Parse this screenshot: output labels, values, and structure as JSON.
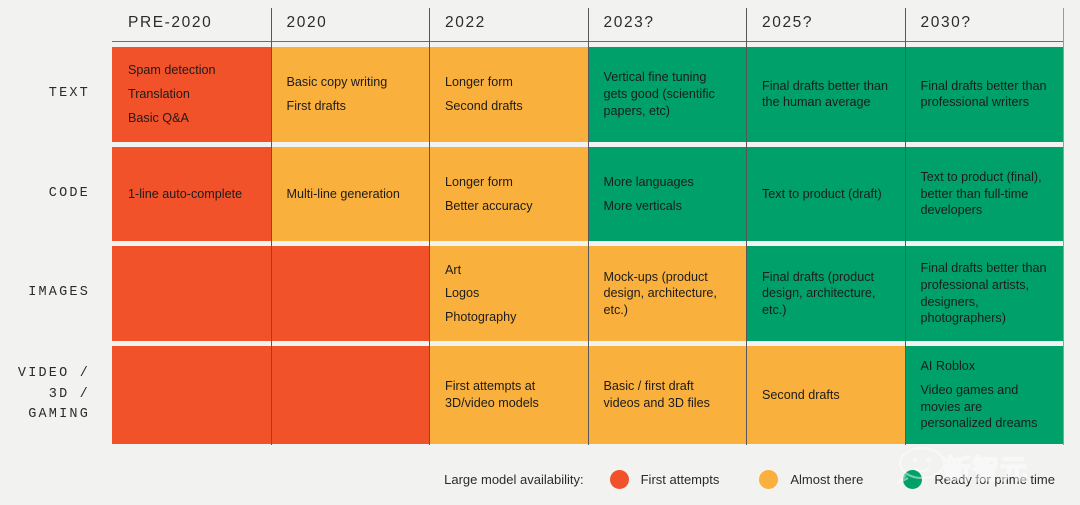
{
  "chart_data": {
    "type": "table",
    "title": "",
    "columns": [
      "PRE-2020",
      "2020",
      "2022",
      "2023?",
      "2025?",
      "2030?"
    ],
    "rows": [
      "TEXT",
      "CODE",
      "IMAGES",
      "VIDEO /\n3D /\nGAMING"
    ],
    "legend_position": "bottom-right",
    "status_levels": [
      {
        "key": "red",
        "label": "First attempts",
        "color": "#F2522A"
      },
      {
        "key": "amber",
        "label": "Almost there",
        "color": "#FAB03C"
      },
      {
        "key": "green",
        "label": "Ready for prime time",
        "color": "#00A06B"
      }
    ],
    "cells": [
      [
        {
          "status": "red",
          "lines": [
            "Spam detection",
            "Translation",
            "Basic Q&A"
          ]
        },
        {
          "status": "amber",
          "lines": [
            "Basic copy writing",
            "First drafts"
          ]
        },
        {
          "status": "amber",
          "lines": [
            "Longer form",
            "Second drafts"
          ]
        },
        {
          "status": "green",
          "lines": [
            "Vertical fine tuning gets good (scientific papers, etc)"
          ]
        },
        {
          "status": "green",
          "lines": [
            "Final drafts better than the human average"
          ]
        },
        {
          "status": "green",
          "lines": [
            "Final drafts better than professional writers"
          ]
        }
      ],
      [
        {
          "status": "red",
          "lines": [
            "1-line auto-complete"
          ]
        },
        {
          "status": "amber",
          "lines": [
            "Multi-line generation"
          ]
        },
        {
          "status": "amber",
          "lines": [
            "Longer form",
            "Better accuracy"
          ]
        },
        {
          "status": "green",
          "lines": [
            "More languages",
            "More verticals"
          ]
        },
        {
          "status": "green",
          "lines": [
            "Text to product (draft)"
          ]
        },
        {
          "status": "green",
          "lines": [
            "Text to product (final), better than full-time developers"
          ]
        }
      ],
      [
        {
          "status": "red",
          "lines": []
        },
        {
          "status": "red",
          "lines": []
        },
        {
          "status": "amber",
          "lines": [
            "Art",
            "Logos",
            "Photography"
          ]
        },
        {
          "status": "amber",
          "lines": [
            "Mock-ups (product design, architecture, etc.)"
          ]
        },
        {
          "status": "green",
          "lines": [
            "Final drafts (product design, architecture, etc.)"
          ]
        },
        {
          "status": "green",
          "lines": [
            "Final drafts better than professional artists, designers, photographers)"
          ]
        }
      ],
      [
        {
          "status": "red",
          "lines": []
        },
        {
          "status": "red",
          "lines": []
        },
        {
          "status": "amber",
          "lines": [
            "First attempts at 3D/video models"
          ]
        },
        {
          "status": "amber",
          "lines": [
            "Basic / first draft videos and 3D files"
          ]
        },
        {
          "status": "amber",
          "lines": [
            "Second drafts"
          ]
        },
        {
          "status": "green",
          "lines": [
            "AI Roblox",
            "Video games and movies are personalized dreams"
          ]
        }
      ]
    ]
  },
  "columns": [
    {
      "label": "PRE-2020"
    },
    {
      "label": "2020"
    },
    {
      "label": "2022"
    },
    {
      "label": "2023?"
    },
    {
      "label": "2025?"
    },
    {
      "label": "2030?"
    }
  ],
  "rows": [
    {
      "label": "TEXT"
    },
    {
      "label": "CODE"
    },
    {
      "label": "IMAGES"
    },
    {
      "label": "VIDEO /\n3D /\nGAMING"
    }
  ],
  "legend": {
    "title": "Large model availability:",
    "items": [
      {
        "label": "First attempts",
        "color": "#F2522A"
      },
      {
        "label": "Almost there",
        "color": "#FAB03C"
      },
      {
        "label": "Ready for prime time",
        "color": "#00A06B"
      }
    ]
  },
  "watermark": {
    "text": "新智元"
  }
}
